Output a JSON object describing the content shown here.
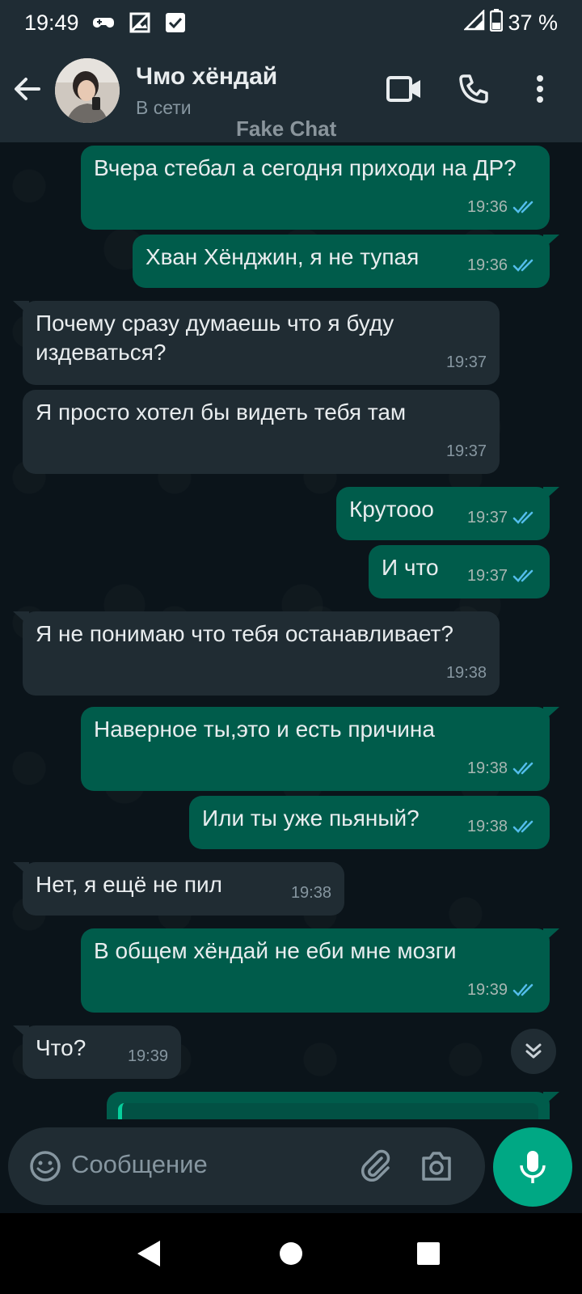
{
  "status_bar": {
    "time": "19:49",
    "battery": "37 %"
  },
  "header": {
    "contact_name": "Чмо хёндай",
    "status": "В сети",
    "watermark": "Fake Chat"
  },
  "messages": [
    {
      "dir": "out",
      "text": "Вчера стебал а сегодня приходи на ДР?",
      "time": "19:36",
      "read": true
    },
    {
      "dir": "out",
      "text": "Хван Хёнджин, я не тупая",
      "time": "19:36",
      "read": true
    },
    {
      "dir": "in",
      "text": "Почему сразу думаешь что я буду издеваться?",
      "time": "19:37"
    },
    {
      "dir": "in",
      "text": "Я просто хотел бы видеть тебя там",
      "time": "19:37"
    },
    {
      "dir": "out",
      "text": "Крутооо",
      "time": "19:37",
      "read": true
    },
    {
      "dir": "out",
      "text": "И что",
      "time": "19:37",
      "read": true
    },
    {
      "dir": "in",
      "text": "Я не понимаю что тебя останавливает?",
      "time": "19:38"
    },
    {
      "dir": "out",
      "text": "Наверное ты,это и есть причина",
      "time": "19:38",
      "read": true
    },
    {
      "dir": "out",
      "text": "Или ты уже пьяный?",
      "time": "19:38",
      "read": true
    },
    {
      "dir": "in",
      "text": "Нет, я ещё не пил",
      "time": "19:38"
    },
    {
      "dir": "out",
      "text": "В общем хёндай не еби мне мозги",
      "time": "19:39",
      "read": true
    },
    {
      "dir": "in",
      "text": "Что?",
      "time": "19:39"
    }
  ],
  "composer": {
    "placeholder": "Сообщение"
  },
  "colors": {
    "outgoing_bubble": "#005c4b",
    "incoming_bubble": "#202c33",
    "accent": "#00a884",
    "read_check": "#53bdeb"
  }
}
